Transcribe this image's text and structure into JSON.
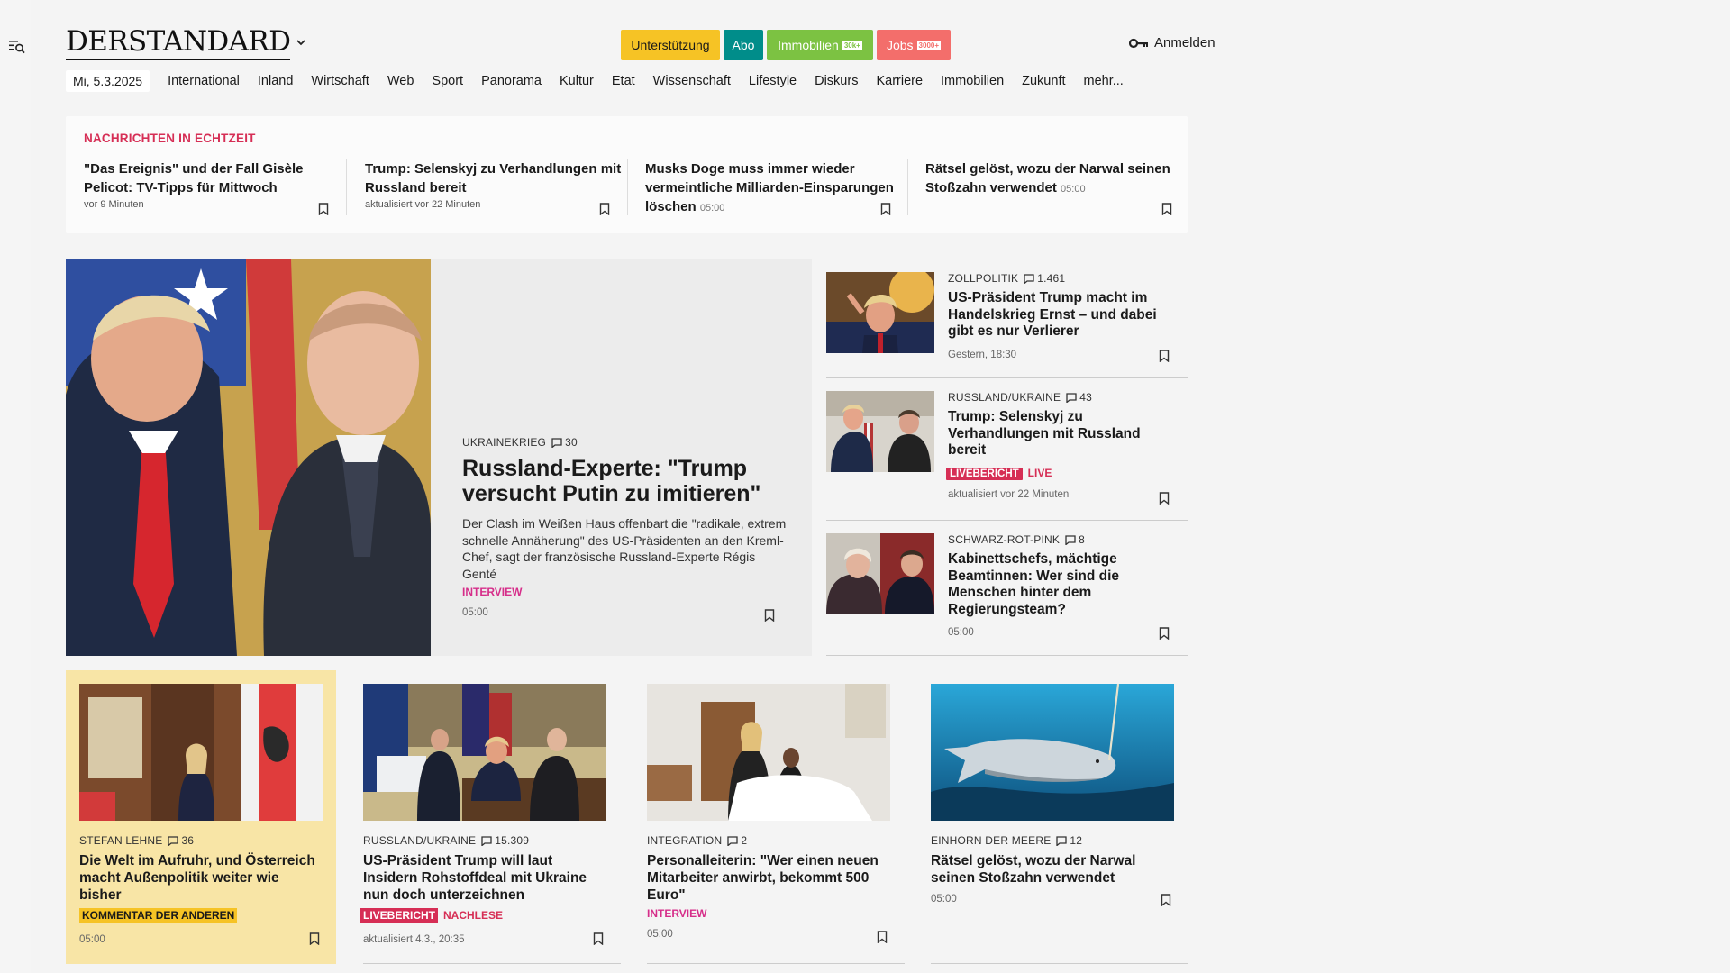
{
  "header": {
    "logo": "DERSTANDARD",
    "buttons": {
      "support": "Unterstützung",
      "abo": "Abo",
      "immo": "Immobilien",
      "immo_badge": "30k+",
      "jobs": "Jobs",
      "jobs_badge": "3000+"
    },
    "login": "Anmelden"
  },
  "nav": {
    "date": "Mi, 5.3.2025",
    "items": [
      "International",
      "Inland",
      "Wirtschaft",
      "Web",
      "Sport",
      "Panorama",
      "Kultur",
      "Etat",
      "Wissenschaft",
      "Lifestyle",
      "Diskurs",
      "Karriere",
      "Immobilien",
      "Zukunft",
      "mehr..."
    ]
  },
  "ticker": {
    "title": "NACHRICHTEN IN ECHTZEIT",
    "items": [
      {
        "title": "\"Das Ereignis\" und der Fall Gisèle Pelicot: TV-Tipps für Mittwoch",
        "meta": "vor 9 Minuten"
      },
      {
        "title": "Trump: Selenskyj zu Verhandlungen mit Russland bereit",
        "meta": "aktualisiert vor 22 Minuten"
      },
      {
        "title": "Musks Doge muss immer wieder vermeintliche Milliarden-Einsparungen löschen",
        "meta": "05:00"
      },
      {
        "title": "Rätsel gelöst, wozu der Narwal seinen Stoßzahn verwendet",
        "meta": "05:00"
      }
    ]
  },
  "hero": {
    "kicker": "UKRAINEKRIEG",
    "comments": "30",
    "title": "Russland-Experte: \"Trump versucht Putin zu imitieren\"",
    "teaser": "Der Clash im Weißen Haus offenbart die \"radikale, extrem schnelle Annäherung\" des US-Präsidenten an den Kreml-Chef, sagt der französische Russland-Experte Régis Genté",
    "label": "INTERVIEW",
    "time": "05:00"
  },
  "side": [
    {
      "kicker": "ZOLLPOLITIK",
      "comments": "1.461",
      "title": "US-Präsident Trump macht im Handelskrieg Ernst – und dabei gibt es nur Verlierer",
      "meta": "Gestern, 18:30"
    },
    {
      "kicker": "RUSSLAND/UKRAINE",
      "comments": "43",
      "title": "Trump: Selenskyj zu Verhandlungen mit Russland bereit",
      "badge": "LIVEBERICHT",
      "live": "LIVE",
      "meta": "aktualisiert vor 22 Minuten"
    },
    {
      "kicker": "SCHWARZ-ROT-PINK",
      "comments": "8",
      "title": "Kabinettschefs, mächtige Beamtinnen: Wer sind die Menschen hinter dem Regierungsteam?",
      "meta": "05:00"
    }
  ],
  "cards": [
    {
      "kicker": "STEFAN LEHNE",
      "comments": "36",
      "title": "Die Welt im Aufruhr, und Österreich macht Außenpolitik weiter wie bisher",
      "badge": "KOMMENTAR DER ANDEREN",
      "meta": "05:00"
    },
    {
      "kicker": "RUSSLAND/UKRAINE",
      "comments": "15.309",
      "title": "US-Präsident Trump will laut Insidern Rohstoffdeal mit Ukraine nun doch unterzeichnen",
      "badge": "LIVEBERICHT",
      "extra": "NACHLESE",
      "meta": "aktualisiert 4.3., 20:35"
    },
    {
      "kicker": "INTEGRATION",
      "comments": "2",
      "title": "Personalleiterin: \"Wer einen neuen Mitarbeiter anwirbt, bekommt 500 Euro\"",
      "label": "INTERVIEW",
      "meta": "05:00"
    },
    {
      "kicker": "EINHORN DER MEERE",
      "comments": "12",
      "title": "Rätsel gelöst, wozu der Narwal seinen Stoßzahn verwendet",
      "meta": "05:00"
    }
  ],
  "colors": {
    "accent_red": "#d62e55",
    "accent_pink": "#d62e8a",
    "support_yellow": "#f6c325",
    "abo_teal": "#008d8a",
    "immo_green": "#7cc242",
    "jobs_red": "#f36e6b"
  }
}
